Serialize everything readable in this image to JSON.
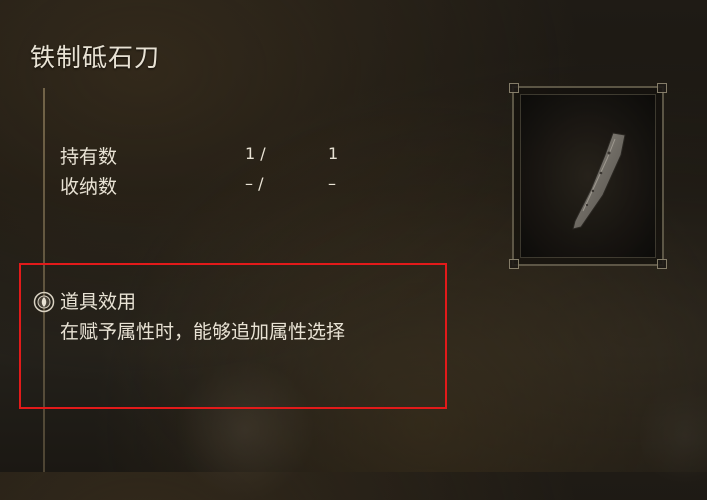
{
  "item": {
    "name": "铁制砥石刀"
  },
  "stats": [
    {
      "label": "持有数",
      "held": "1 /",
      "max": "1"
    },
    {
      "label": "收纳数",
      "held": "– /",
      "max": "–"
    }
  ],
  "effect": {
    "icon": "item-effect-icon",
    "heading": "道具效用",
    "description": "在赋予属性时，能够追加属性选择"
  },
  "colors": {
    "highlight_box": "#e21a1a",
    "text": "#e8e2d4"
  }
}
